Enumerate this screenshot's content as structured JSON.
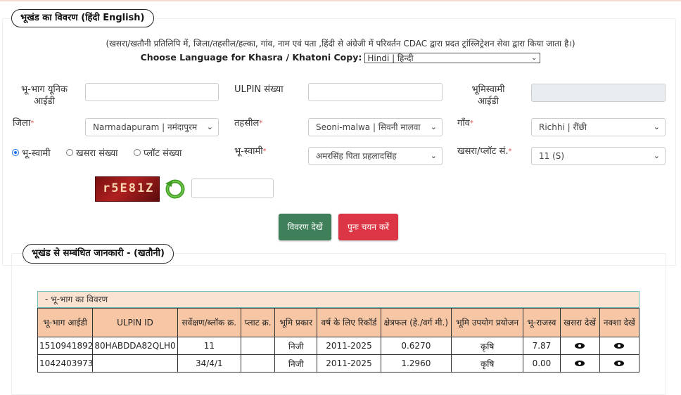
{
  "section1": {
    "legend": "भूखंड का विवरण (हिंदी English)",
    "note": "(खसरा/खतौनी प्रतिलिपि में, जिला/तहसील/हल्का, गांव, नाम एवं पता ,हिंदी से अंग्रेजी में परिवर्तन CDAC द्वारा प्रदत ट्रांस्लिट्रेशन सेवा द्वारा किया जाता है।)",
    "language_label": "Choose Language for Khasra / Khatoni Copy:",
    "language_value": "Hindi | हिन्दी"
  },
  "form": {
    "unique_id_label": "भू-भाग यूनिक आईडी",
    "ulpin_label": "ULPIN संख्या",
    "bhoomiswami_id_label": "भूमिस्वामी आईडी",
    "district_label": "जिला",
    "district_value": "Narmadapuram | नमंदापुरम",
    "tehsil_label": "तहसील",
    "tehsil_value": "Seoni-malwa | सिवनी मालवा",
    "village_label": "गाँव",
    "village_value": "Richhi | रींछी",
    "radio_owner": "भू-स्वामी",
    "radio_khasra": "खसरा संख्या",
    "radio_plot": "प्लॉट संख्या",
    "owner_label": "भू-स्वामी",
    "owner_value": "अमरसिंह पिता प्रहलादसिंह",
    "khasra_label": "खसरा/प्लॉट सं.",
    "khasra_value": "11 (S)",
    "required_mark": "*",
    "captcha_text": "r5E81Z"
  },
  "buttons": {
    "view": "विवरण देखें",
    "reset": "पुनः चयन करें"
  },
  "section2": {
    "legend": "भूखंड से सम्बंधित जानकारी - (खतौनी)",
    "table_title": "- भू-भाग का विवरण",
    "headers": [
      "भू-भाग आईडी",
      "ULPIN ID",
      "सर्वेक्षण/ब्लॉक क्र.",
      "प्लाट क्र.",
      "भूमि प्रकार",
      "वर्ष के लिए रिकॉर्ड",
      "क्षेत्रफल (हे./वर्ग मी.)",
      "भूमि उपयोग प्रयोजन",
      "भू-राजस्व",
      "खसरा देखें",
      "नक्शा देखें"
    ],
    "rows": [
      {
        "id": "1510941892",
        "ulpin": "80HABDDA82QLH0",
        "survey": "11",
        "plot": "",
        "type": "निजी",
        "year": "2011-2025",
        "area": "0.6270",
        "use": "कृषि",
        "revenue": "7.87"
      },
      {
        "id": "1042403973",
        "ulpin": "",
        "survey": "34/4/1",
        "plot": "",
        "type": "निजी",
        "year": "2011-2025",
        "area": "1.2960",
        "use": "कृषि",
        "revenue": "0.00"
      }
    ]
  },
  "colors": {
    "view_button": "#3f7f5a",
    "reset_button": "#dc3545",
    "table_header": "#f7c6a4"
  }
}
